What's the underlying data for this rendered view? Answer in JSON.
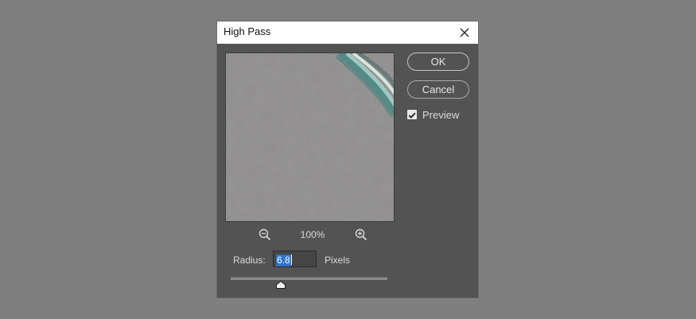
{
  "dialog": {
    "title": "High Pass",
    "close_icon": "close-icon"
  },
  "preview": {
    "zoom_level": "100%",
    "zoom_out_icon": "zoom-out-icon",
    "zoom_in_icon": "zoom-in-icon"
  },
  "radius": {
    "label": "Radius:",
    "value": "6.8",
    "unit": "Pixels",
    "slider_fraction": 0.32
  },
  "buttons": {
    "ok": "OK",
    "cancel": "Cancel"
  },
  "preview_toggle": {
    "label": "Preview",
    "checked": true
  },
  "colors": {
    "background": "#7f7f7f",
    "dialog": "#535353",
    "selection": "#2f73c9"
  }
}
